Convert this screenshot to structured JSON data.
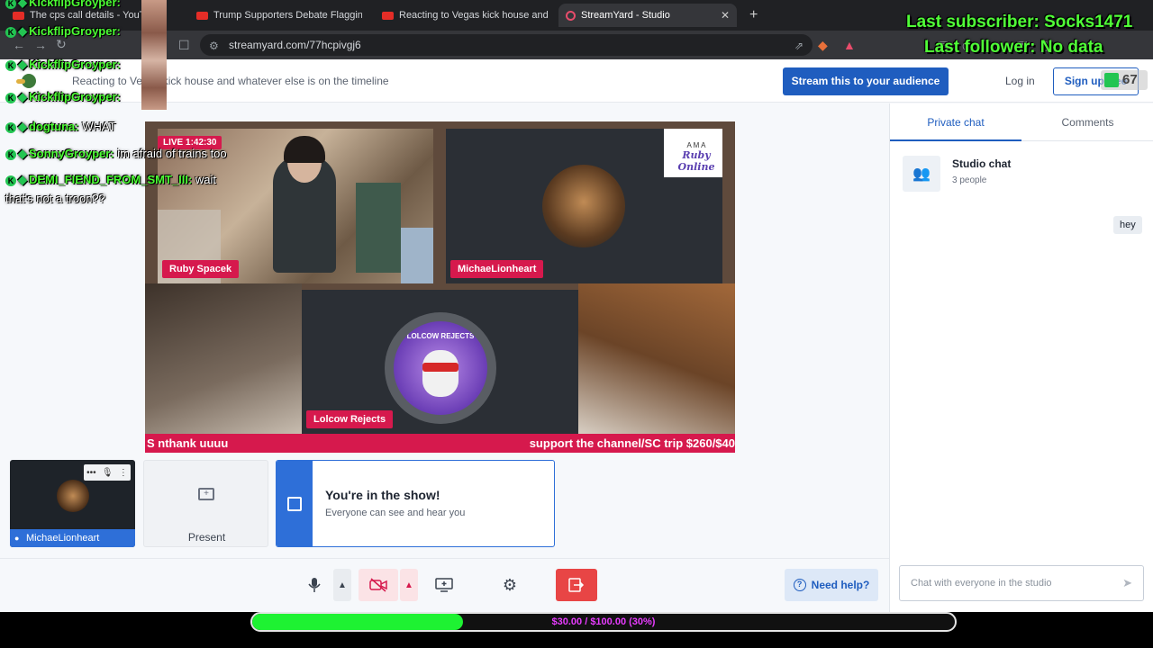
{
  "browser": {
    "tabs": [
      {
        "title": "The cps call details - YouTube",
        "active": false
      },
      {
        "title": "Trump Supporters Debate Flagging B",
        "active": false
      },
      {
        "title": "Reacting to Vegas kick house and wh",
        "active": false
      },
      {
        "title": "StreamYard - Studio",
        "active": true
      }
    ],
    "new_tab_symbol": "+",
    "url": "streamyard.com/77hcpivgj6"
  },
  "header": {
    "broadcast_title": "Reacting to Vegas kick house and whatever else is on the timeline",
    "stream_button": "Stream this to your audience",
    "login_label": "Log in",
    "signup_label": "Sign up free"
  },
  "stage": {
    "live_timer": "LIVE 1:42:30",
    "participants": [
      {
        "name": "Ruby Spacek"
      },
      {
        "name": "MichaeLionheart"
      },
      {
        "name": "Lolcow Rejects"
      }
    ],
    "logo_text": "Ruby Online",
    "logo_subtext": "A M A",
    "lolcow_logo_text": "LOLCOW REJECTS",
    "ticker_left": "S nthank uuuu",
    "ticker_right": "support the channel/SC trip $260/$40"
  },
  "participants_row": {
    "self_name": "MichaeLionheart",
    "present_label": "Present",
    "banner_title": "You're in the show!",
    "banner_subtitle": "Everyone can see and hear you"
  },
  "controls": {
    "help_label": "Need help?"
  },
  "sidepanel": {
    "tabs": [
      {
        "label": "Private chat",
        "active": true
      },
      {
        "label": "Comments",
        "active": false
      }
    ],
    "chat_title": "Studio chat",
    "chat_members": "3 people",
    "messages": [
      {
        "text": "hey"
      }
    ],
    "input_placeholder": "Chat with everyone in the studio"
  },
  "overlay": {
    "chat": [
      {
        "user": "KickflipGroyper:",
        "text": ""
      },
      {
        "user": "KickflipGroyper:",
        "text": ""
      },
      {
        "user": "KickflipGroyper:",
        "text": ""
      },
      {
        "user": "KickflipGroyper:",
        "text": ""
      },
      {
        "user": "dogtuna:",
        "text": "WHAT"
      },
      {
        "user": "SonnyGroyper:",
        "text": "im afraid of trains too"
      },
      {
        "user": "DEMI_FIEND_FROM_SMT_III:",
        "text": "wait"
      }
    ],
    "chat_continuation": "that's not a troon??",
    "badge_letter": "K",
    "last_subscriber": "Last subscriber: Socks1471",
    "last_follower": "Last follower: No data",
    "viewer_count": "67",
    "donation_text": "$30.00 / $100.00 (30%)",
    "donation_fraction": 0.3
  },
  "colors": {
    "accent_blue": "#1f5dbf",
    "brand_red": "#d6194d",
    "overlay_green": "#4cff34",
    "donation_fill": "#1ef232",
    "donation_text": "#e83cff"
  },
  "icons": {
    "back": "arrow-left-icon",
    "forward": "arrow-right-icon",
    "reload": "reload-icon",
    "site_info": "site-info-icon",
    "share": "share-icon",
    "bookmark": "bookmark-icon",
    "mic": "microphone-icon",
    "camera_off": "camera-off-icon",
    "screen_share": "screen-share-icon",
    "settings": "gear-icon",
    "leave": "leave-icon",
    "send": "send-icon",
    "people": "people-icon"
  }
}
